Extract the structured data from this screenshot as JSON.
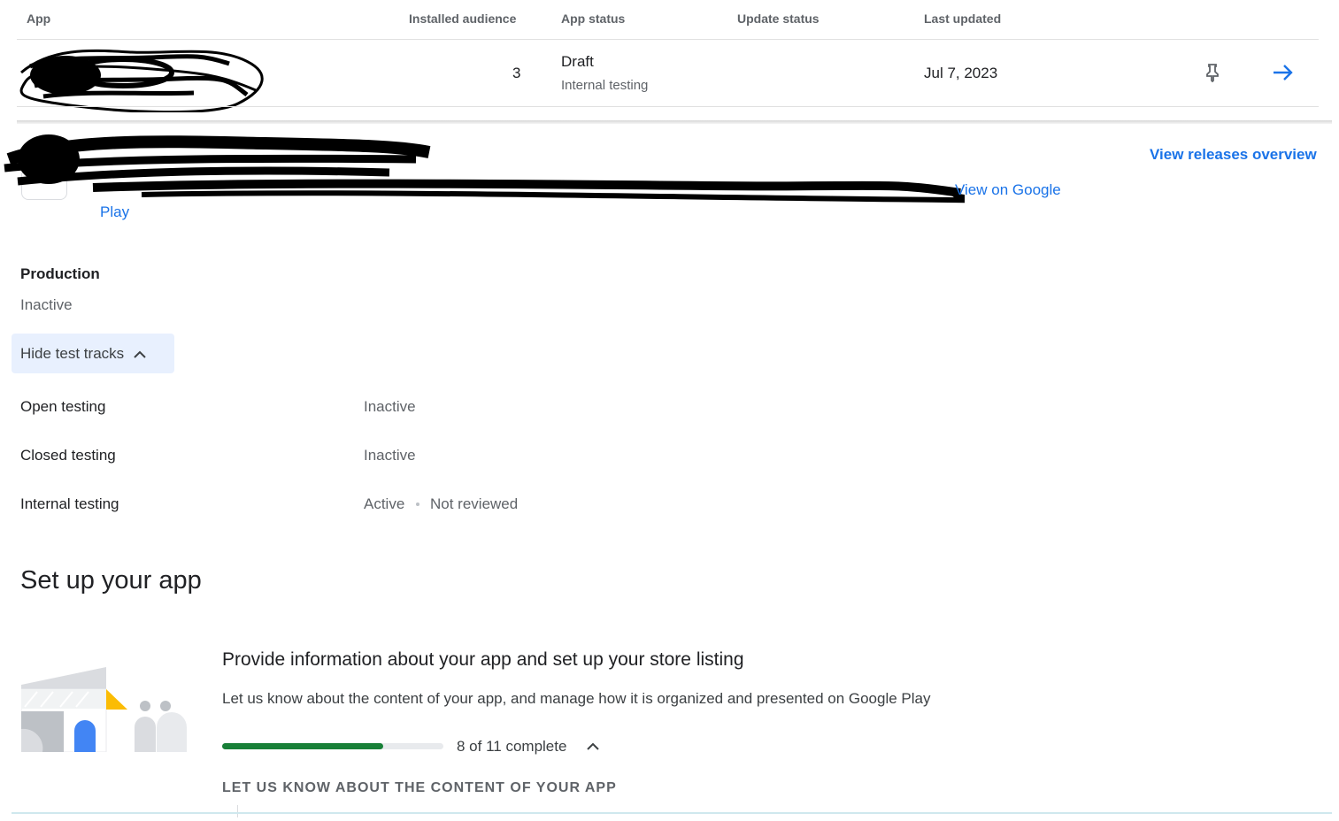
{
  "table": {
    "headers": {
      "app": "App",
      "installed_audience": "Installed audience",
      "app_status": "App status",
      "update_status": "Update status",
      "last_updated": "Last updated"
    },
    "row": {
      "installed_audience": "3",
      "app_status": "Draft",
      "app_status_track": "Internal testing",
      "update_status": "",
      "last_updated": "Jul 7, 2023",
      "pin_icon": "pin-icon",
      "open_icon": "arrow-right-icon"
    }
  },
  "app_header": {
    "view_releases_overview": "View releases overview",
    "view_on_google_play_line1": "View on Google",
    "view_on_google_play_line2": "Play"
  },
  "production": {
    "label": "Production",
    "status": "Inactive"
  },
  "test_tracks": {
    "toggle_label": "Hide test tracks",
    "tracks": [
      {
        "name": "Open testing",
        "status": "Inactive",
        "review": ""
      },
      {
        "name": "Closed testing",
        "status": "Inactive",
        "review": ""
      },
      {
        "name": "Internal testing",
        "status": "Active",
        "review": "Not reviewed"
      }
    ]
  },
  "setup": {
    "title": "Set up your app",
    "task_title": "Provide information about your app and set up your store listing",
    "task_description": "Let us know about the content of your app, and manage how it is organized and presented on Google Play",
    "progress_text": "8 of 11 complete",
    "progress_fraction": 0.7273,
    "section_heading": "LET US KNOW ABOUT THE CONTENT OF YOUR APP"
  },
  "colors": {
    "link": "#1a73e8",
    "progress": "#188038",
    "toggle_bg": "#e8f0fe"
  }
}
